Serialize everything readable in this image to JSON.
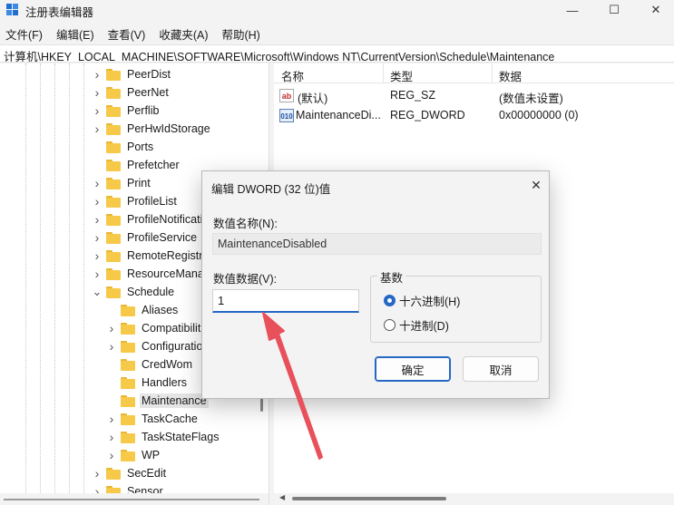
{
  "window": {
    "title": "注册表编辑器",
    "controls": {
      "minimize": "—",
      "maximize": "☐",
      "close": "✕"
    }
  },
  "menu": [
    "文件(F)",
    "编辑(E)",
    "查看(V)",
    "收藏夹(A)",
    "帮助(H)"
  ],
  "address": "计算机\\HKEY_LOCAL_MACHINE\\SOFTWARE\\Microsoft\\Windows NT\\CurrentVersion\\Schedule\\Maintenance",
  "tree": {
    "items": [
      {
        "label": "PeerDist",
        "level": 1,
        "expander": "collapsed"
      },
      {
        "label": "PeerNet",
        "level": 1,
        "expander": "collapsed"
      },
      {
        "label": "Perflib",
        "level": 1,
        "expander": "collapsed"
      },
      {
        "label": "PerHwIdStorage",
        "level": 1,
        "expander": "collapsed"
      },
      {
        "label": "Ports",
        "level": 1,
        "expander": "none"
      },
      {
        "label": "Prefetcher",
        "level": 1,
        "expander": "none"
      },
      {
        "label": "Print",
        "level": 1,
        "expander": "collapsed"
      },
      {
        "label": "ProfileList",
        "level": 1,
        "expander": "collapsed"
      },
      {
        "label": "ProfileNotificati",
        "level": 1,
        "expander": "collapsed"
      },
      {
        "label": "ProfileService",
        "level": 1,
        "expander": "collapsed"
      },
      {
        "label": "RemoteRegistr",
        "level": 1,
        "expander": "collapsed"
      },
      {
        "label": "ResourceMana",
        "level": 1,
        "expander": "collapsed"
      },
      {
        "label": "Schedule",
        "level": 1,
        "expander": "expanded"
      },
      {
        "label": "Aliases",
        "level": 2,
        "expander": "none"
      },
      {
        "label": "Compatibilit",
        "level": 2,
        "expander": "collapsed"
      },
      {
        "label": "Configuratio",
        "level": 2,
        "expander": "collapsed"
      },
      {
        "label": "CredWom",
        "level": 2,
        "expander": "none"
      },
      {
        "label": "Handlers",
        "level": 2,
        "expander": "none"
      },
      {
        "label": "Maintenance",
        "level": 2,
        "expander": "none",
        "selected": true
      },
      {
        "label": "TaskCache",
        "level": 2,
        "expander": "collapsed"
      },
      {
        "label": "TaskStateFlags",
        "level": 2,
        "expander": "collapsed"
      },
      {
        "label": "WP",
        "level": 2,
        "expander": "collapsed"
      },
      {
        "label": "SecEdit",
        "level": 1,
        "expander": "collapsed"
      },
      {
        "label": "Sensor",
        "level": 1,
        "expander": "collapsed"
      }
    ]
  },
  "list": {
    "columns": [
      "名称",
      "类型",
      "数据"
    ],
    "rows": [
      {
        "icon": "string-value-icon",
        "icon_text": "ab",
        "name": "(默认)",
        "type": "REG_SZ",
        "data": "(数值未设置)"
      },
      {
        "icon": "dword-value-icon",
        "icon_text": "010",
        "name": "MaintenanceDi...",
        "type": "REG_DWORD",
        "data": "0x00000000 (0)"
      }
    ]
  },
  "dialog": {
    "title": "编辑 DWORD (32 位)值",
    "close": "✕",
    "name_label": "数值名称(N):",
    "name_value": "MaintenanceDisabled",
    "data_label": "数值数据(V):",
    "data_value": "1",
    "base_label": "基数",
    "radio_hex": "十六进制(H)",
    "radio_dec": "十进制(D)",
    "selected_base": "hex",
    "ok": "确定",
    "cancel": "取消"
  },
  "colors": {
    "accent": "#2567c5",
    "annotation_arrow": "#e8505b",
    "folder": "#f7c948"
  }
}
